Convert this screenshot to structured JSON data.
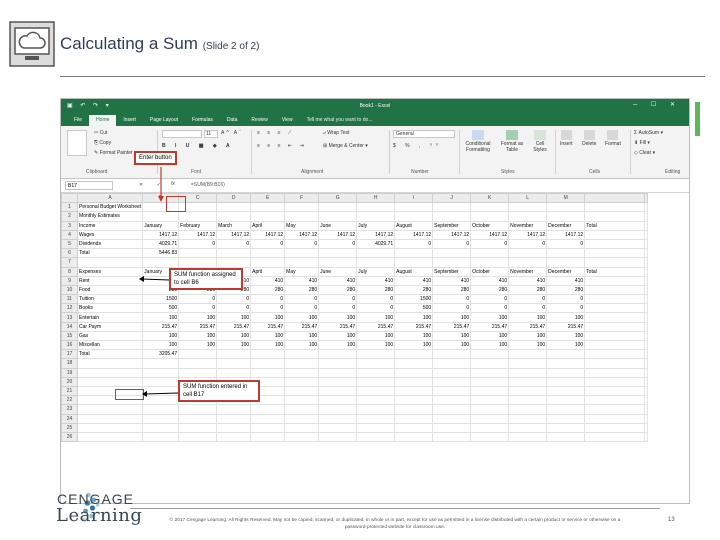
{
  "slide": {
    "title": "Calculating a Sum",
    "subtitle": "(Slide 2 of 2)",
    "copyright_line1": "© 2017 Cengage Learning. All Rights Reserved. May not be copied, scanned, or duplicated, in whole or in part, except for use as permitted in a license distributed with a certain product or service or otherwise on a",
    "copyright_line2": "password-protected website for classroom use.",
    "page_number": "13",
    "logo_line1": "CENGAGE",
    "logo_line2": "Learning"
  },
  "excel": {
    "title_bar": "Book1 - Excel",
    "tabs": [
      "File",
      "Home",
      "Insert",
      "Page Layout",
      "Formulas",
      "Data",
      "Review",
      "View",
      "Tell me what you want to do..."
    ],
    "ribbon": {
      "cut": "Cut",
      "copy": "Copy",
      "format_painter": "Format Painter",
      "font_size": "11",
      "wrap_text": "Wrap Text",
      "merge_center": "Merge & Center",
      "number_format": "General",
      "conditional_formatting": "Conditional Formatting",
      "format_as_table": "Format as Table",
      "cell_styles": "Cell Styles",
      "insert": "Insert",
      "delete": "Delete",
      "format": "Format",
      "autosum": "AutoSum",
      "fill": "Fill",
      "clear": "Clear",
      "groups": [
        "Clipboard",
        "Font",
        "Alignment",
        "Number",
        "Styles",
        "Cells",
        "Editing"
      ]
    },
    "name_box": "B17",
    "formula_symbols": "✕ ✓",
    "fx": "fx",
    "formula": "=SUM(B9:B16)",
    "columns": [
      "A",
      "B",
      "C",
      "D",
      "E",
      "F",
      "G",
      "H",
      "I",
      "J",
      "K",
      "L",
      "M"
    ],
    "rows": [
      {
        "n": "1",
        "cells": [
          "Personal Budget Worksheet",
          "",
          "",
          "",
          "",
          "",
          "",
          "",
          "",
          "",
          "",
          "",
          ""
        ]
      },
      {
        "n": "2",
        "cells": [
          "Monthly Estimates",
          "",
          "",
          "",
          "",
          "",
          "",
          "",
          "",
          "",
          "",
          "",
          ""
        ]
      },
      {
        "n": "3",
        "cells": [
          "Income",
          "January",
          "February",
          "March",
          "April",
          "May",
          "June",
          "July",
          "August",
          "September",
          "October",
          "November",
          "December",
          "Total"
        ]
      },
      {
        "n": "4",
        "cells": [
          "Wages",
          "1417.12",
          "1417.12",
          "1417.12",
          "1417.12",
          "1417.12",
          "1417.12",
          "1417.12",
          "1417.12",
          "1417.12",
          "1417.12",
          "1417.12",
          "1417.12"
        ]
      },
      {
        "n": "5",
        "cells": [
          "Dividends",
          "4029.71",
          "0",
          "0",
          "0",
          "0",
          "0",
          "4029.71",
          "0",
          "0",
          "0",
          "0",
          "0"
        ]
      },
      {
        "n": "6",
        "cells": [
          "Total",
          "5446.83",
          "",
          "",
          "",
          "",
          "",
          "",
          "",
          "",
          "",
          "",
          ""
        ]
      },
      {
        "n": "7",
        "cells": [
          "",
          "",
          "",
          "",
          "",
          "",
          "",
          "",
          "",
          "",
          "",
          "",
          ""
        ]
      },
      {
        "n": "8",
        "cells": [
          "Expenses",
          "January",
          "February",
          "March",
          "April",
          "May",
          "June",
          "July",
          "August",
          "September",
          "October",
          "November",
          "December",
          "Total"
        ]
      },
      {
        "n": "9",
        "cells": [
          "Rent",
          "410",
          "410",
          "410",
          "410",
          "410",
          "410",
          "410",
          "410",
          "410",
          "410",
          "410",
          "410"
        ]
      },
      {
        "n": "10",
        "cells": [
          "Food",
          "280",
          "280",
          "280",
          "280",
          "280",
          "280",
          "280",
          "280",
          "280",
          "280",
          "280",
          "280"
        ]
      },
      {
        "n": "11",
        "cells": [
          "Tuition",
          "1500",
          "0",
          "0",
          "0",
          "0",
          "0",
          "0",
          "1500",
          "0",
          "0",
          "0",
          "0"
        ]
      },
      {
        "n": "12",
        "cells": [
          "Books",
          "500",
          "0",
          "0",
          "0",
          "0",
          "0",
          "0",
          "500",
          "0",
          "0",
          "0",
          "0"
        ]
      },
      {
        "n": "13",
        "cells": [
          "Entertain",
          "100",
          "100",
          "100",
          "100",
          "100",
          "100",
          "100",
          "100",
          "100",
          "100",
          "100",
          "100"
        ]
      },
      {
        "n": "14",
        "cells": [
          "Car Paym",
          "215.47",
          "215.47",
          "215.47",
          "215.47",
          "215.47",
          "215.47",
          "215.47",
          "215.47",
          "215.47",
          "215.47",
          "215.47",
          "215.47"
        ]
      },
      {
        "n": "15",
        "cells": [
          "Gas",
          "100",
          "100",
          "100",
          "100",
          "100",
          "100",
          "100",
          "100",
          "100",
          "100",
          "100",
          "100"
        ]
      },
      {
        "n": "16",
        "cells": [
          "Miscellan",
          "100",
          "100",
          "100",
          "100",
          "100",
          "100",
          "100",
          "100",
          "100",
          "100",
          "100",
          "100"
        ]
      },
      {
        "n": "17",
        "cells": [
          "Total",
          "3205.47",
          "",
          "",
          "",
          "",
          "",
          "",
          "",
          "",
          "",
          "",
          ""
        ]
      },
      {
        "n": "18",
        "cells": [
          "",
          "",
          "",
          "",
          "",
          "",
          "",
          "",
          "",
          "",
          "",
          "",
          ""
        ]
      },
      {
        "n": "19",
        "cells": [
          "",
          "",
          "",
          "",
          "",
          "",
          "",
          "",
          "",
          "",
          "",
          "",
          ""
        ]
      },
      {
        "n": "20",
        "cells": [
          "",
          "",
          "",
          "",
          "",
          "",
          "",
          "",
          "",
          "",
          "",
          "",
          ""
        ]
      },
      {
        "n": "21",
        "cells": [
          "",
          "",
          "",
          "",
          "",
          "",
          "",
          "",
          "",
          "",
          "",
          "",
          ""
        ]
      },
      {
        "n": "22",
        "cells": [
          "",
          "",
          "",
          "",
          "",
          "",
          "",
          "",
          "",
          "",
          "",
          "",
          ""
        ]
      },
      {
        "n": "23",
        "cells": [
          "",
          "",
          "",
          "",
          "",
          "",
          "",
          "",
          "",
          "",
          "",
          "",
          ""
        ]
      },
      {
        "n": "24",
        "cells": [
          "",
          "",
          "",
          "",
          "",
          "",
          "",
          "",
          "",
          "",
          "",
          "",
          ""
        ]
      },
      {
        "n": "25",
        "cells": [
          "",
          "",
          "",
          "",
          "",
          "",
          "",
          "",
          "",
          "",
          "",
          "",
          ""
        ]
      },
      {
        "n": "26",
        "cells": [
          "",
          "",
          "",
          "",
          "",
          "",
          "",
          "",
          "",
          "",
          "",
          "",
          ""
        ]
      }
    ]
  },
  "callouts": {
    "enter_button": "Enter button",
    "sum_b6": "SUM function assigned to cell B6",
    "sum_b17": "SUM function entered in cell B17"
  },
  "colors": {
    "excel_green": "#217346",
    "callout": "#c0392b",
    "title": "#2f3e56"
  }
}
